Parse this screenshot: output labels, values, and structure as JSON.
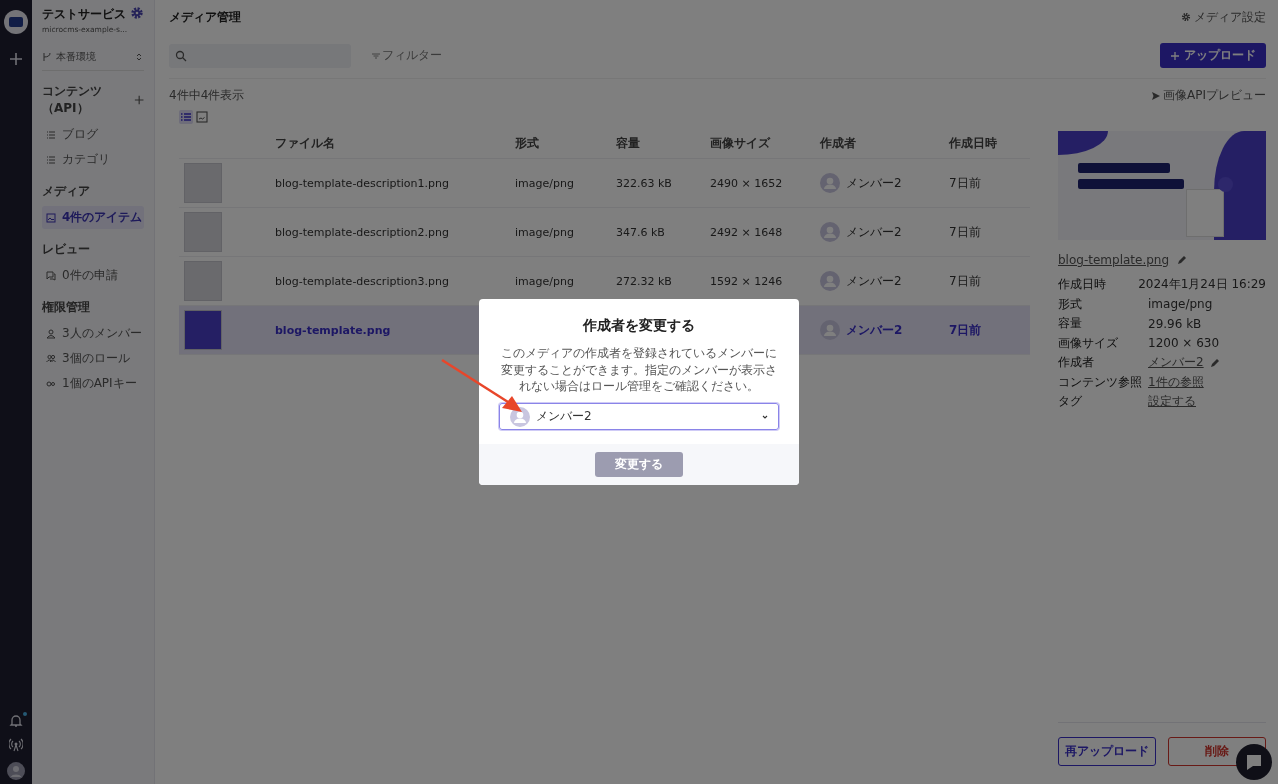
{
  "rail": {
    "notification": true
  },
  "sidebar": {
    "service_name": "テストサービス",
    "service_id": "microcms-example-s...",
    "environment": "本番環境",
    "sections": [
      {
        "title": "コンテンツ（API）",
        "addable": true,
        "items": [
          {
            "label": "ブログ",
            "kind": "list",
            "selected": false
          },
          {
            "label": "カテゴリ",
            "kind": "list",
            "selected": false
          }
        ]
      },
      {
        "title": "メディア",
        "addable": false,
        "items": [
          {
            "label": "4件のアイテム",
            "kind": "image",
            "selected": true
          }
        ]
      },
      {
        "title": "レビュー",
        "addable": false,
        "items": [
          {
            "label": "0件の申請",
            "kind": "review",
            "selected": false
          }
        ]
      },
      {
        "title": "権限管理",
        "addable": false,
        "items": [
          {
            "label": "3人のメンバー",
            "kind": "member",
            "selected": false
          },
          {
            "label": "3個のロール",
            "kind": "role",
            "selected": false
          },
          {
            "label": "1個のAPIキー",
            "kind": "key",
            "selected": false
          }
        ]
      }
    ]
  },
  "header": {
    "title": "メディア管理",
    "settings": "メディア設定"
  },
  "toolbar": {
    "filter": "フィルター",
    "upload": "アップロード"
  },
  "count": "4件中4件表示",
  "image_api_preview": "画像APIプレビュー",
  "views": [
    {
      "kind": "list",
      "selected": true
    },
    {
      "kind": "grid",
      "selected": false
    }
  ],
  "table": {
    "columns": [
      "ファイル名",
      "形式",
      "容量",
      "画像サイズ",
      "作成者",
      "作成日時"
    ],
    "rows": [
      {
        "name": "blog-template-description1.png",
        "format": "image/png",
        "size": "322.63 kB",
        "dimensions": "2490 × 1652",
        "author": "メンバー2",
        "date": "7日前",
        "selected": false
      },
      {
        "name": "blog-template-description2.png",
        "format": "image/png",
        "size": "347.6 kB",
        "dimensions": "2492 × 1648",
        "author": "メンバー2",
        "date": "7日前",
        "selected": false
      },
      {
        "name": "blog-template-description3.png",
        "format": "image/png",
        "size": "272.32 kB",
        "dimensions": "1592 × 1246",
        "author": "メンバー2",
        "date": "7日前",
        "selected": false
      },
      {
        "name": "blog-template.png",
        "author": "メンバー2",
        "date": "7日前",
        "selected": true
      }
    ]
  },
  "detail": {
    "file_name": "blog-template.png",
    "fields": [
      {
        "label": "作成日時",
        "value": "2024年1月24日 16:29",
        "kind": "text",
        "editable": false
      },
      {
        "label": "形式",
        "value": "image/png",
        "kind": "text",
        "editable": false
      },
      {
        "label": "容量",
        "value": "29.96 kB",
        "kind": "text",
        "editable": false
      },
      {
        "label": "画像サイズ",
        "value": "1200 × 630",
        "kind": "text",
        "editable": false
      },
      {
        "label": "作成者",
        "value": "メンバー2",
        "kind": "link",
        "editable": true
      },
      {
        "label": "コンテンツ参照",
        "value": "1件の参照",
        "kind": "link",
        "editable": false
      },
      {
        "label": "タグ",
        "value": "設定する",
        "kind": "link",
        "editable": false
      }
    ],
    "reupload": "再アップロード",
    "delete": "削除"
  },
  "modal": {
    "title": "作成者を変更する",
    "description": "このメディアの作成者を登録されているメンバーに変更することができます。指定のメンバーが表示されない場合はロール管理をご確認ください。",
    "select": "メンバー2",
    "submit": "変更する",
    "submit_disabled": true
  }
}
